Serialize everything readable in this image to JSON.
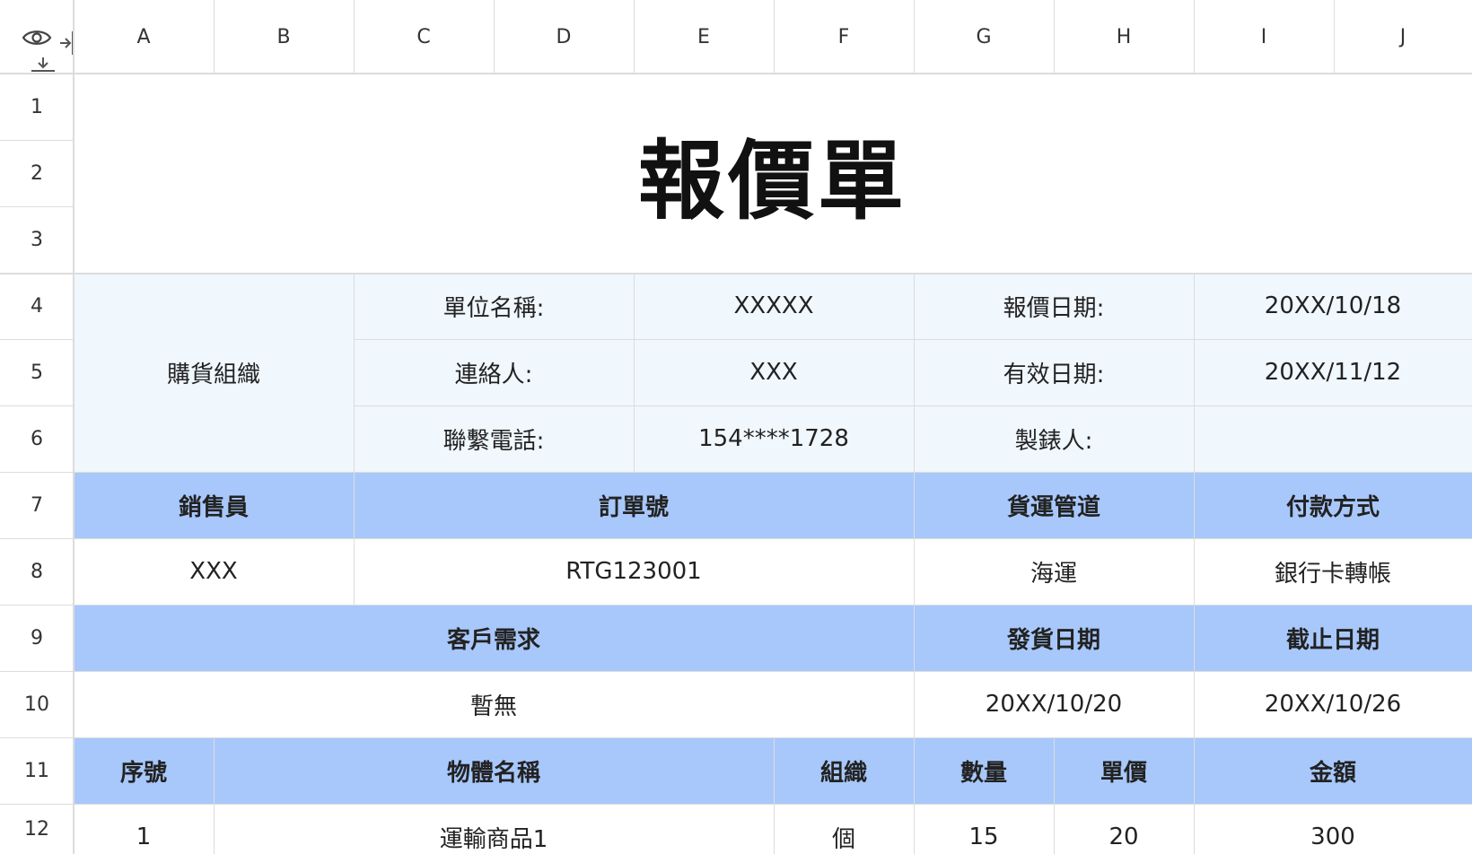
{
  "columns": [
    "A",
    "B",
    "C",
    "D",
    "E",
    "F",
    "G",
    "H",
    "I",
    "J"
  ],
  "rows": [
    "1",
    "2",
    "3",
    "4",
    "5",
    "6",
    "7",
    "8",
    "9",
    "10",
    "11",
    "12"
  ],
  "title": "報價單",
  "info": {
    "purchasing_org": "購貨組織",
    "unit_name_label": "單位名稱:",
    "unit_name_value": "XXXXX",
    "quote_date_label": "報價日期:",
    "quote_date_value": "20XX/10/18",
    "contact_label": "連絡人:",
    "contact_value": "XXX",
    "valid_date_label": "有效日期:",
    "valid_date_value": "20XX/11/12",
    "phone_label": "聯繫電話:",
    "phone_value": "154****1728",
    "maker_label": "製錶人:",
    "maker_value": ""
  },
  "row7": {
    "salesperson": "銷售員",
    "order_no": "訂單號",
    "shipping": "貨運管道",
    "payment": "付款方式"
  },
  "row8": {
    "salesperson": "XXX",
    "order_no": "RTG123001",
    "shipping": "海運",
    "payment": "銀行卡轉帳"
  },
  "row9": {
    "customer_needs": "客戶需求",
    "ship_date": "發貨日期",
    "deadline": "截止日期"
  },
  "row10": {
    "customer_needs": "暫無",
    "ship_date": "20XX/10/20",
    "deadline": "20XX/10/26"
  },
  "row11": {
    "seq": "序號",
    "item_name": "物體名稱",
    "unit": "組織",
    "qty": "數量",
    "price": "單價",
    "amount": "金額"
  },
  "row12": {
    "seq": "1",
    "item_name": "運輸商品1",
    "unit": "個",
    "qty": "15",
    "price": "20",
    "amount": "300"
  },
  "colors": {
    "header_blue": "#a8c8fb",
    "info_light": "#f0f7fd",
    "grid": "#dcdcdc"
  },
  "icons": {
    "corner_view": "eye-icon",
    "collapse_cols": "collapse-columns-icon",
    "collapse_rows": "collapse-rows-icon"
  }
}
